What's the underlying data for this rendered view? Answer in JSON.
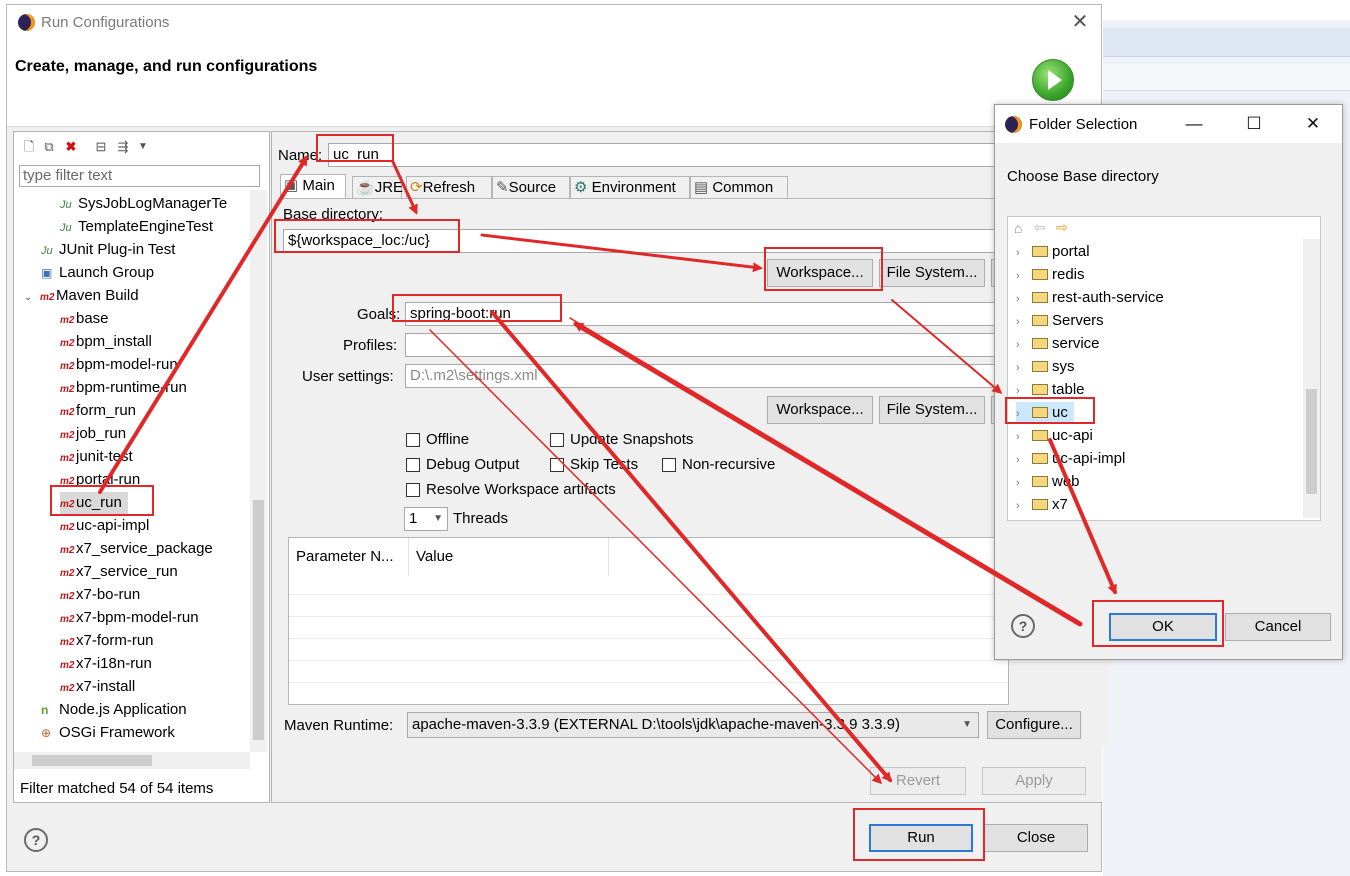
{
  "main_dialog": {
    "title": "Run Configurations",
    "header": "Create, manage, and run configurations",
    "filter_placeholder": "type filter text",
    "tree": [
      {
        "label": "SysJobLogManagerTe",
        "icon": "junit-icon",
        "kind": "junit"
      },
      {
        "label": "TemplateEngineTest",
        "icon": "junit-icon",
        "kind": "junit"
      },
      {
        "label": "JUnit Plug-in Test",
        "icon": "junit-plugin-icon",
        "kind": "category"
      },
      {
        "label": "Launch Group",
        "icon": "launch-group-icon",
        "kind": "category"
      },
      {
        "label": "Maven Build",
        "icon": "m2-icon",
        "kind": "expanded"
      },
      {
        "label": "base",
        "icon": "m2-icon",
        "kind": "m2"
      },
      {
        "label": "bpm_install",
        "icon": "m2-icon",
        "kind": "m2"
      },
      {
        "label": "bpm-model-run",
        "icon": "m2-icon",
        "kind": "m2"
      },
      {
        "label": "bpm-runtime-run",
        "icon": "m2-icon",
        "kind": "m2"
      },
      {
        "label": "form_run",
        "icon": "m2-icon",
        "kind": "m2"
      },
      {
        "label": "job_run",
        "icon": "m2-icon",
        "kind": "m2"
      },
      {
        "label": "junit-test",
        "icon": "m2-icon",
        "kind": "m2"
      },
      {
        "label": "portal-run",
        "icon": "m2-icon",
        "kind": "m2"
      },
      {
        "label": "uc_run",
        "icon": "m2-icon",
        "kind": "m2-selected"
      },
      {
        "label": "uc-api-impl",
        "icon": "m2-icon",
        "kind": "m2"
      },
      {
        "label": "x7_service_package",
        "icon": "m2-icon",
        "kind": "m2"
      },
      {
        "label": "x7_service_run",
        "icon": "m2-icon",
        "kind": "m2"
      },
      {
        "label": "x7-bo-run",
        "icon": "m2-icon",
        "kind": "m2"
      },
      {
        "label": "x7-bpm-model-run",
        "icon": "m2-icon",
        "kind": "m2"
      },
      {
        "label": "x7-form-run",
        "icon": "m2-icon",
        "kind": "m2"
      },
      {
        "label": "x7-i18n-run",
        "icon": "m2-icon",
        "kind": "m2"
      },
      {
        "label": "x7-install",
        "icon": "m2-icon",
        "kind": "m2"
      },
      {
        "label": "Node.js Application",
        "icon": "nodejs-icon",
        "kind": "category"
      },
      {
        "label": "OSGi Framework",
        "icon": "osgi-icon",
        "kind": "category"
      }
    ],
    "filter_status": "Filter matched 54 of 54 items",
    "name_label": "Name:",
    "name_value": "uc_run",
    "tabs": [
      "Main",
      "JRE",
      "Refresh",
      "Source",
      "Environment",
      "Common"
    ],
    "base_dir_label": "Base directory:",
    "base_dir_value": "${workspace_loc:/uc}",
    "workspace_btn": "Workspace...",
    "filesystem_btn": "File System...",
    "goals_label": "Goals:",
    "goals_value": "spring-boot:run",
    "profiles_label": "Profiles:",
    "profiles_value": "",
    "user_settings_label": "User settings:",
    "user_settings_value": "D:\\.m2\\settings.xml",
    "checkboxes": {
      "offline": "Offline",
      "update_snapshots": "Update Snapshots",
      "debug_output": "Debug Output",
      "skip_tests": "Skip Tests",
      "non_recursive": "Non-recursive",
      "resolve_workspace": "Resolve Workspace artifacts"
    },
    "threads_value": "1",
    "threads_label": "Threads",
    "table_headers": [
      "Parameter N...",
      "Value"
    ],
    "maven_runtime_label": "Maven Runtime:",
    "maven_runtime_value": "apache-maven-3.3.9 (EXTERNAL D:\\tools\\jdk\\apache-maven-3.3.9 3.3.9)",
    "configure_btn": "Configure...",
    "revert_btn": "Revert",
    "apply_btn": "Apply",
    "run_btn": "Run",
    "close_btn": "Close"
  },
  "folder_dialog": {
    "title": "Folder Selection",
    "prompt": "Choose Base directory",
    "items": [
      "portal",
      "redis",
      "rest-auth-service",
      "Servers",
      "service",
      "sys",
      "table",
      "uc",
      "uc-api",
      "uc-api-impl",
      "web",
      "x7"
    ],
    "selected": "uc",
    "ok_btn": "OK",
    "cancel_btn": "Cancel"
  },
  "colors": {
    "annotation": "#e02828",
    "selection": "#cce8ff",
    "default_button_border": "#2c7ad6"
  }
}
